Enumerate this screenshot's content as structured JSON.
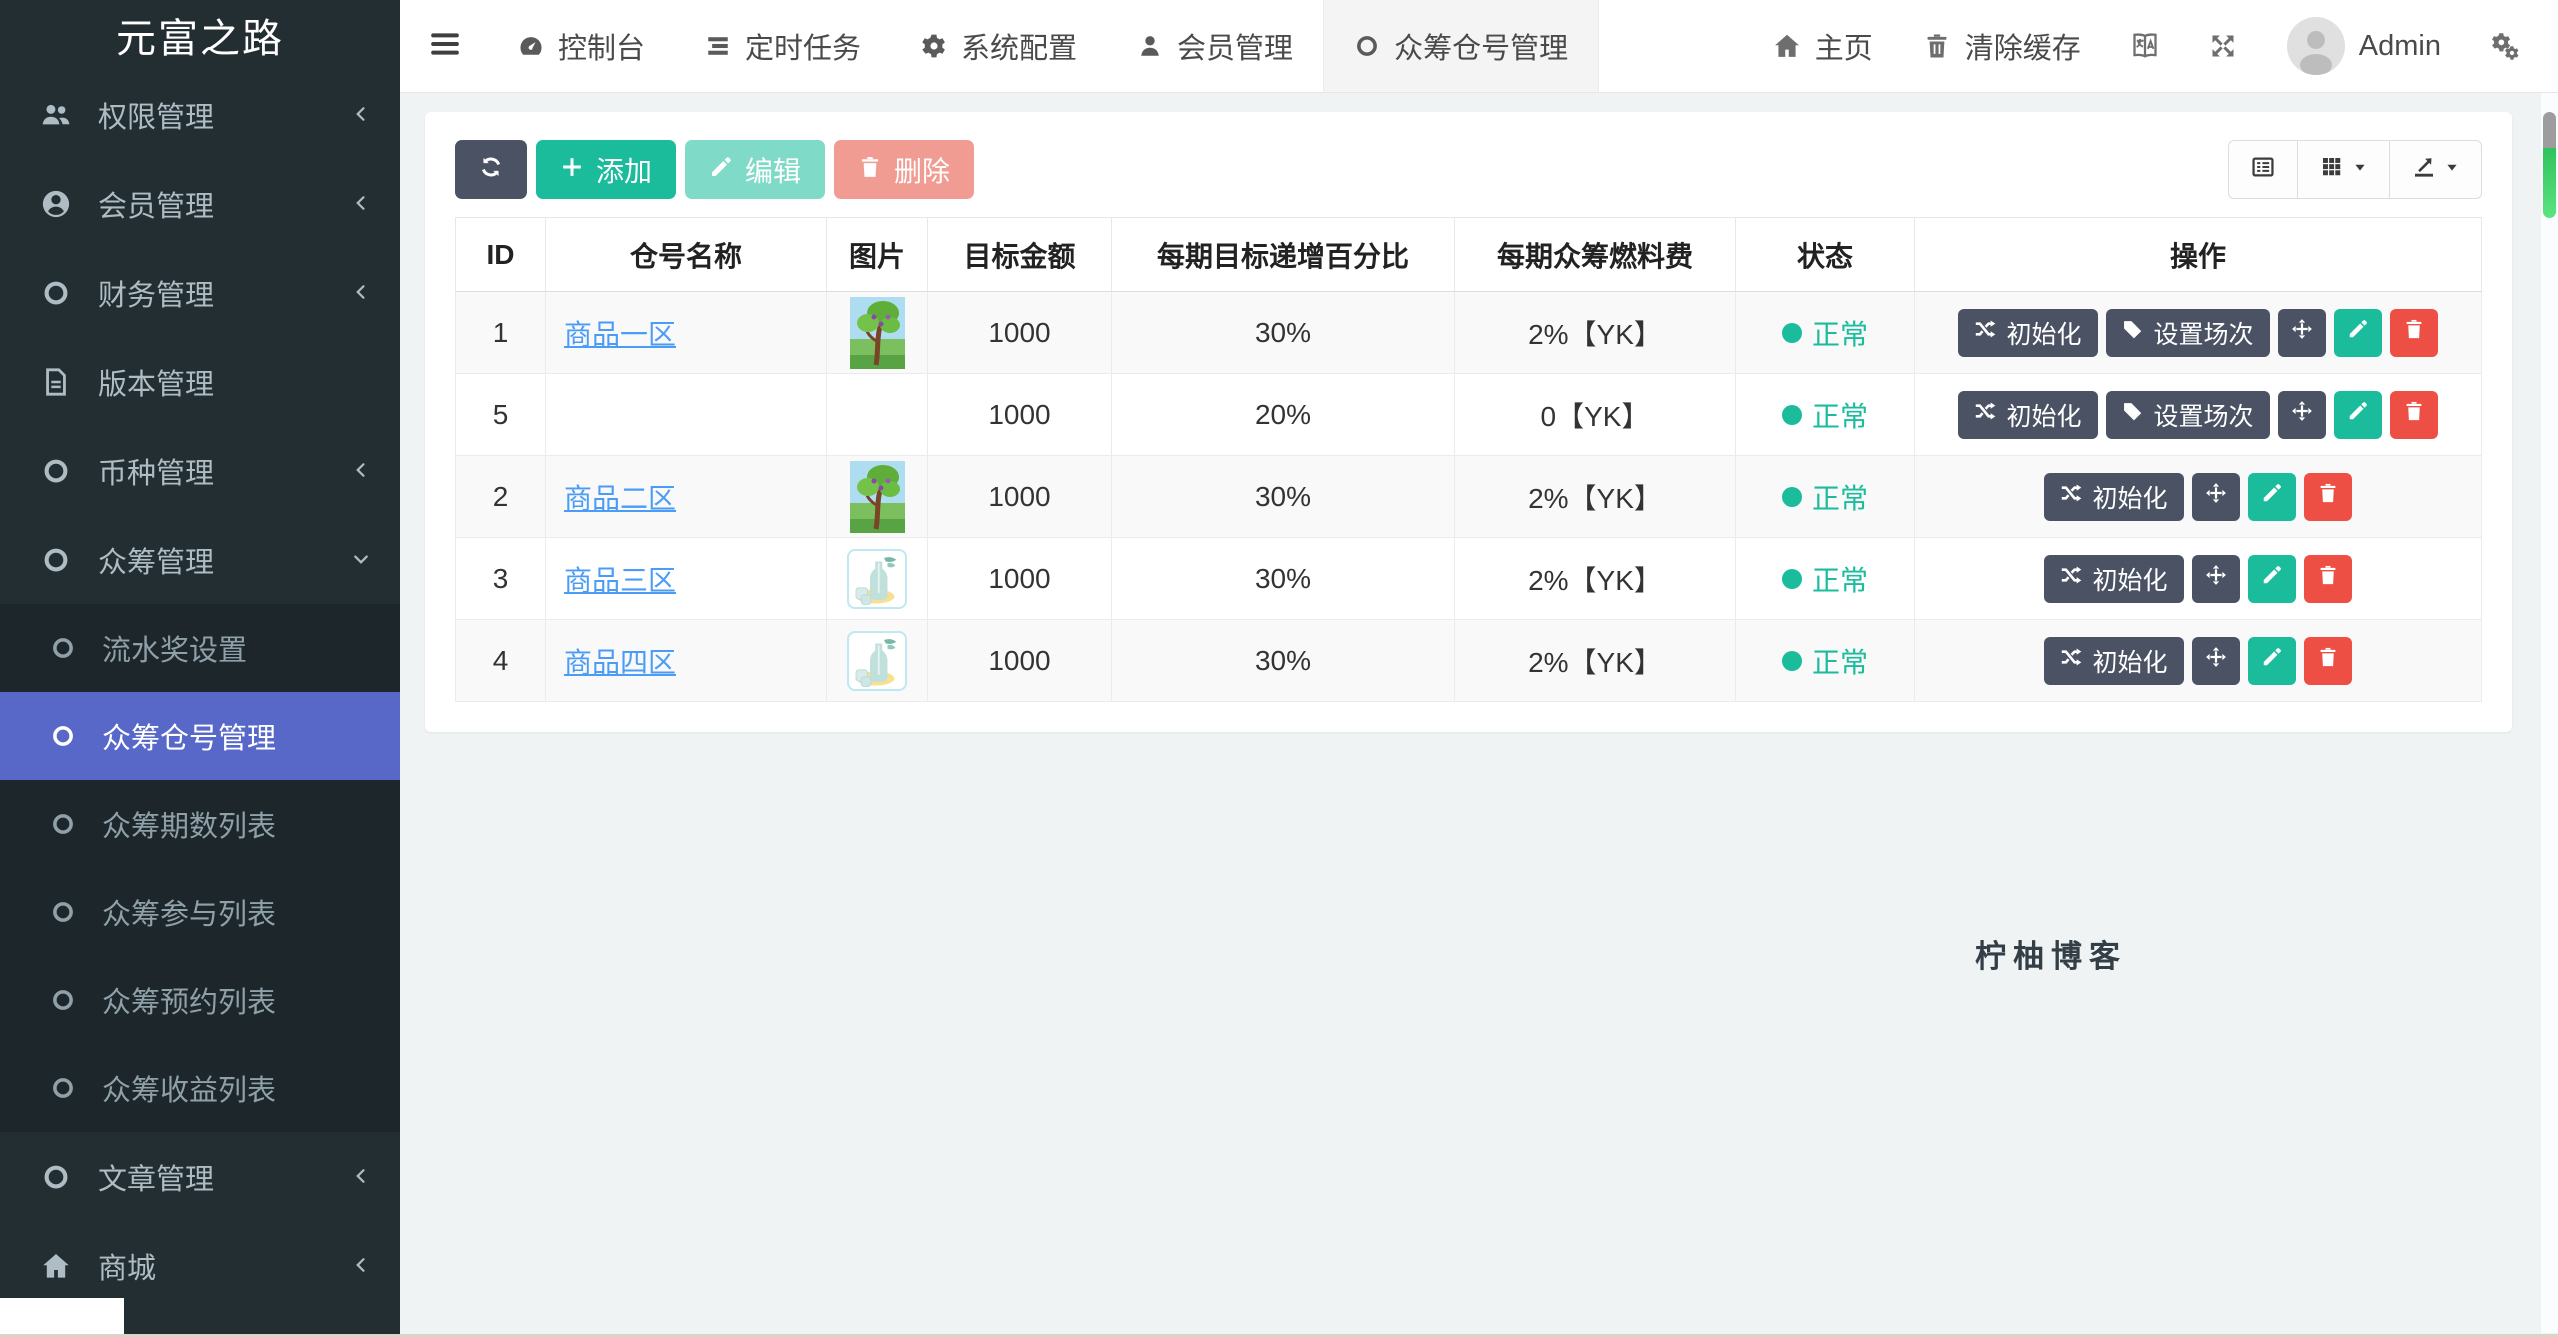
{
  "app": {
    "watermark": "柠柚博客"
  },
  "colors": {
    "sidebar_bg": "#232e33",
    "submenu_bg": "#1c262b",
    "active_item": "#5768c8",
    "success": "#1abc9c",
    "danger": "#e74c3c",
    "dark_button": "#4a5264",
    "link": "#4b9cf7",
    "status_normal": "#1abc9c",
    "content_bg": "#eff3f4"
  },
  "sidebar": {
    "logo": "元富之路",
    "menu": [
      {
        "key": "permissions",
        "label": "权限管理",
        "icon": "users-icon",
        "chevron": "left"
      },
      {
        "key": "members",
        "label": "会员管理",
        "icon": "user-circle-icon",
        "chevron": "left"
      },
      {
        "key": "finance",
        "label": "财务管理",
        "icon": "circle-icon",
        "chevron": "left"
      },
      {
        "key": "version",
        "label": "版本管理",
        "icon": "file-icon",
        "chevron": "none"
      },
      {
        "key": "currency",
        "label": "币种管理",
        "icon": "circle-icon",
        "chevron": "left"
      },
      {
        "key": "crowdfund",
        "label": "众筹管理",
        "icon": "circle-icon",
        "chevron": "down",
        "expanded": true,
        "children": [
          {
            "key": "flow-award-settings",
            "label": "流水奖设置",
            "active": false
          },
          {
            "key": "crowdfund-warehouse",
            "label": "众筹仓号管理",
            "active": true
          },
          {
            "key": "crowdfund-periods",
            "label": "众筹期数列表",
            "active": false
          },
          {
            "key": "crowdfund-participation",
            "label": "众筹参与列表",
            "active": false
          },
          {
            "key": "crowdfund-reservation",
            "label": "众筹预约列表",
            "active": false
          },
          {
            "key": "crowdfund-income",
            "label": "众筹收益列表",
            "active": false
          }
        ]
      },
      {
        "key": "articles",
        "label": "文章管理",
        "icon": "circle-icon",
        "chevron": "left"
      },
      {
        "key": "mall",
        "label": "商城",
        "icon": "home-icon",
        "chevron": "left"
      }
    ]
  },
  "topbar": {
    "tabs": [
      {
        "key": "dashboard",
        "label": "控制台",
        "icon": "dashboard-icon",
        "active": false
      },
      {
        "key": "scheduled-tasks",
        "label": "定时任务",
        "icon": "tasks-icon",
        "active": false
      },
      {
        "key": "system-config",
        "label": "系统配置",
        "icon": "gear-icon",
        "active": false
      },
      {
        "key": "member-management",
        "label": "会员管理",
        "icon": "user-icon",
        "active": false
      },
      {
        "key": "crowdfund-warehouse",
        "label": "众筹仓号管理",
        "icon": "circle-icon",
        "active": true
      }
    ],
    "right_items": [
      {
        "key": "home",
        "label": "主页",
        "icon": "home-icon"
      },
      {
        "key": "clear-cache",
        "label": "清除缓存",
        "icon": "trash-icon"
      },
      {
        "key": "language",
        "icon": "translate-icon"
      },
      {
        "key": "fullscreen",
        "icon": "expand-icon"
      },
      {
        "key": "user",
        "label": "Admin",
        "icon": "avatar"
      },
      {
        "key": "settings",
        "icon": "cogs-icon"
      }
    ]
  },
  "toolbar": {
    "buttons": [
      {
        "key": "refresh",
        "label": "",
        "icon": "refresh-icon",
        "style": "dark",
        "disabled": false
      },
      {
        "key": "add",
        "label": "添加",
        "icon": "plus-icon",
        "style": "success",
        "disabled": false
      },
      {
        "key": "edit",
        "label": "编辑",
        "icon": "pencil-icon",
        "style": "success",
        "disabled": true
      },
      {
        "key": "delete",
        "label": "删除",
        "icon": "trash-icon",
        "style": "danger",
        "disabled": true
      }
    ],
    "view_buttons": [
      {
        "key": "detail-view",
        "icon": "list-alt-icon",
        "caret": false
      },
      {
        "key": "columns",
        "icon": "grid-icon",
        "caret": true
      },
      {
        "key": "export",
        "icon": "export-icon",
        "caret": true
      }
    ]
  },
  "table": {
    "headers": [
      "ID",
      "仓号名称",
      "图片",
      "目标金额",
      "每期目标递增百分比",
      "每期众筹燃料费",
      "状态",
      "操作"
    ],
    "action_labels": {
      "init": "初始化",
      "session": "设置场次"
    },
    "status_normal": "正常",
    "rows": [
      {
        "id": "1",
        "name": "商品一区",
        "image": "tree",
        "amount": "1000",
        "percent": "30%",
        "fuel": "2%【YK】",
        "status": "正常",
        "actions": [
          "init",
          "session",
          "move",
          "edit",
          "delete"
        ]
      },
      {
        "id": "5",
        "name": "",
        "image": "",
        "amount": "1000",
        "percent": "20%",
        "fuel": "0【YK】",
        "status": "正常",
        "actions": [
          "init",
          "session",
          "move",
          "edit",
          "delete"
        ]
      },
      {
        "id": "2",
        "name": "商品二区",
        "image": "tree",
        "amount": "1000",
        "percent": "30%",
        "fuel": "2%【YK】",
        "status": "正常",
        "actions": [
          "init",
          "move",
          "edit",
          "delete"
        ]
      },
      {
        "id": "3",
        "name": "商品三区",
        "image": "bottle",
        "amount": "1000",
        "percent": "30%",
        "fuel": "2%【YK】",
        "status": "正常",
        "actions": [
          "init",
          "move",
          "edit",
          "delete"
        ]
      },
      {
        "id": "4",
        "name": "商品四区",
        "image": "bottle",
        "amount": "1000",
        "percent": "30%",
        "fuel": "2%【YK】",
        "status": "正常",
        "actions": [
          "init",
          "move",
          "edit",
          "delete"
        ]
      }
    ]
  }
}
